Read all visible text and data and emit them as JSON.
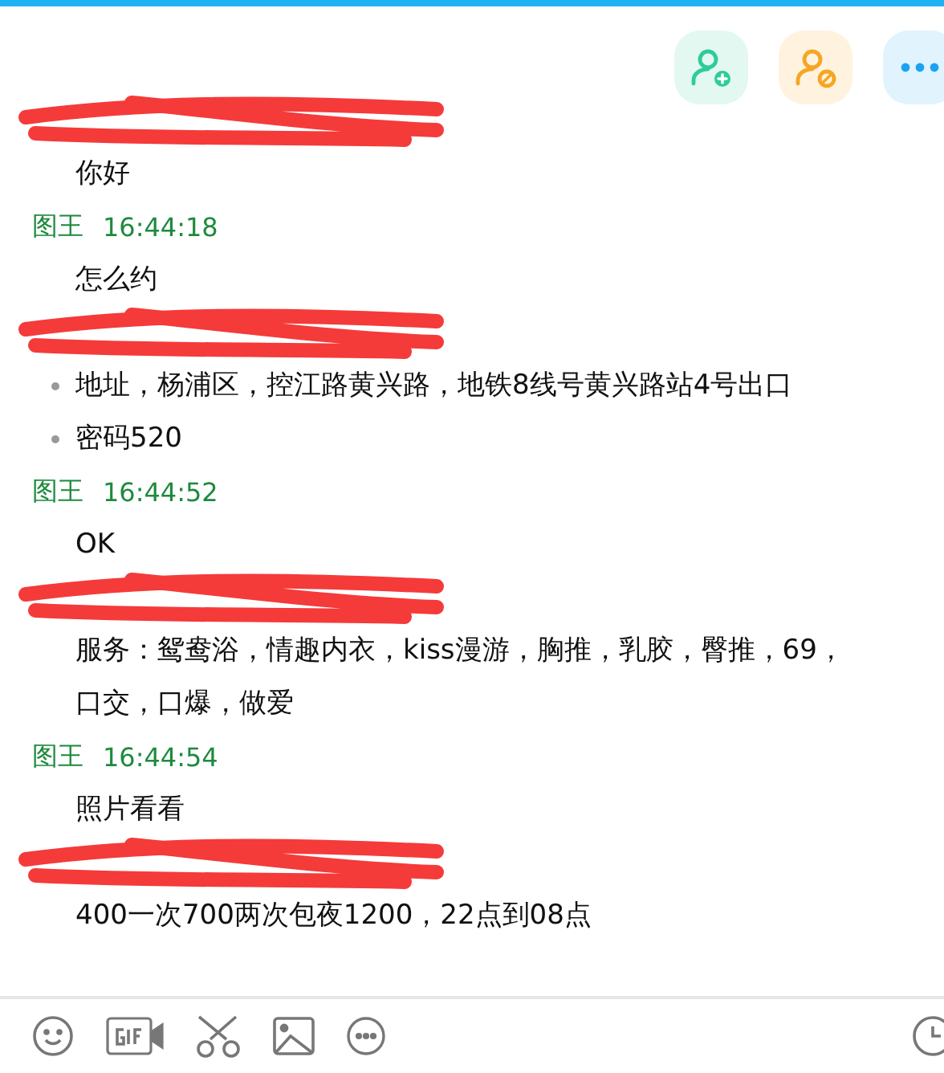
{
  "messages": [
    {
      "kind": "redacted",
      "lines": [
        {
          "text": "你好",
          "bullet": false
        }
      ]
    },
    {
      "kind": "named",
      "sender": "图王",
      "time": "16:44:18",
      "lines": [
        {
          "text": "怎么约",
          "bullet": false
        }
      ]
    },
    {
      "kind": "redacted",
      "lines": [
        {
          "text": "地址，杨浦区，控江路黄兴路，地铁8线号黄兴路站4号出口",
          "bullet": true
        },
        {
          "text": "密码520",
          "bullet": true
        }
      ]
    },
    {
      "kind": "named",
      "sender": "图王",
      "time": "16:44:52",
      "lines": [
        {
          "text": "OK",
          "bullet": false
        }
      ]
    },
    {
      "kind": "redacted",
      "lines": [
        {
          "text": "服务：鸳鸯浴，情趣内衣，kiss漫游，胸推，乳胶，臀推，69，口交，口爆，做爱",
          "bullet": false
        }
      ]
    },
    {
      "kind": "named",
      "sender": "图王",
      "time": "16:44:54",
      "lines": [
        {
          "text": "照片看看",
          "bullet": false
        }
      ]
    },
    {
      "kind": "redacted",
      "lines": [
        {
          "text": "400一次700两次包夜1200，22点到08点",
          "bullet": false
        }
      ]
    }
  ]
}
